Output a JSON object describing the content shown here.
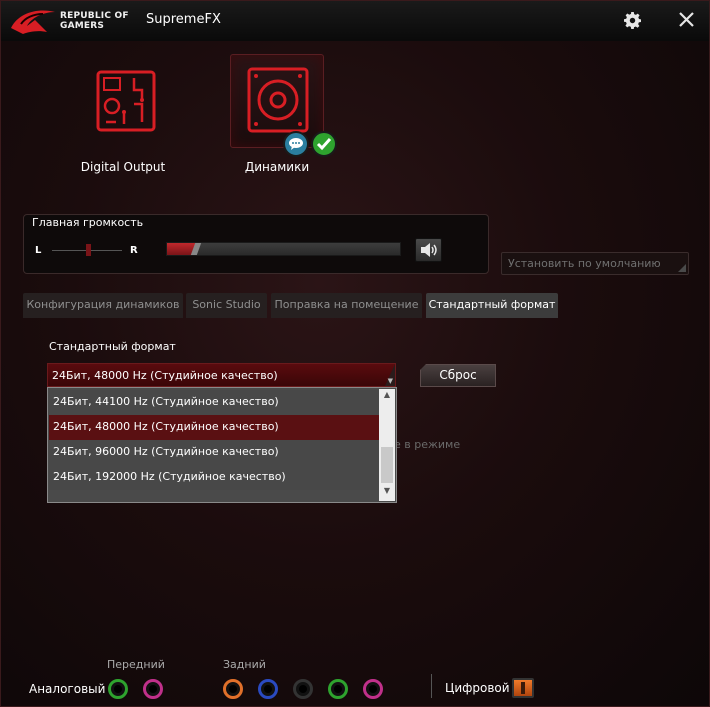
{
  "app": {
    "brand_line1": "REPUBLIC OF",
    "brand_line2": "GAMERS",
    "title": "SupremeFX"
  },
  "devices": [
    {
      "label": "Digital Output",
      "selected": false
    },
    {
      "label": "Динамики",
      "selected": true
    }
  ],
  "volume": {
    "title": "Главная громкость",
    "left_label": "L",
    "right_label": "R",
    "balance": 0.5,
    "level_fraction": 0.12,
    "set_default_label": "Установить по умолчанию"
  },
  "tabs": [
    {
      "label": "Конфигурация динамиков",
      "active": false
    },
    {
      "label": "Sonic Studio",
      "active": false
    },
    {
      "label": "Поправка на помещение",
      "active": false
    },
    {
      "label": "Стандартный формат",
      "active": true
    }
  ],
  "format": {
    "section_title": "Стандартный формат",
    "selected_value": "24Бит, 48000 Hz (Студийное качество)",
    "reset_label": "Сброс",
    "obscured_text": "е в режиме",
    "options": [
      "24Бит, 44100 Hz (Студийное качество)",
      "24Бит, 48000 Hz (Студийное качество)",
      "24Бит, 96000 Hz (Студийное качество)",
      "24Бит, 192000 Hz (Студийное качество)"
    ]
  },
  "jacks": {
    "front_label": "Передний",
    "rear_label": "Задний",
    "analog_label": "Аналоговый",
    "digital_label": "Цифровой",
    "colors": {
      "front_green": "#2ea32e",
      "front_pink": "#c0308a",
      "rear_orange": "#e0702a",
      "rear_blue": "#2a4ac0",
      "rear_black": "#333333",
      "rear_green": "#2ea32e",
      "rear_pink": "#c0308a"
    }
  },
  "theme": {
    "accent": "#7a1418",
    "background": "#1b0c0d"
  }
}
